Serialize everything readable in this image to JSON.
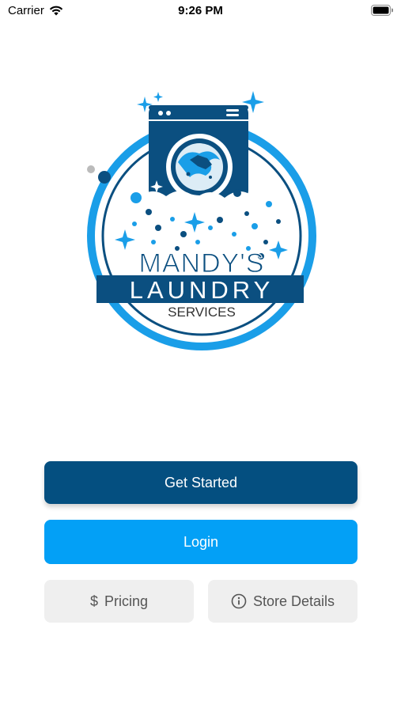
{
  "status_bar": {
    "carrier": "Carrier",
    "time": "9:26 PM"
  },
  "logo": {
    "line1": "MANDY'S",
    "line2": "LAUNDRY",
    "line3": "SERVICES",
    "colors": {
      "navy": "#0b4f80",
      "sky": "#1a9ee8",
      "dark_text": "#333333"
    }
  },
  "actions": {
    "get_started": "Get Started",
    "login": "Login",
    "pricing": "Pricing",
    "store_details": "Store Details"
  },
  "icons": {
    "pricing": "dollar-icon",
    "store_details": "info-icon"
  },
  "colors": {
    "primary": "#044f80",
    "accent": "#03a0f6",
    "secondary_bg": "#efefef",
    "secondary_text": "#555555"
  }
}
